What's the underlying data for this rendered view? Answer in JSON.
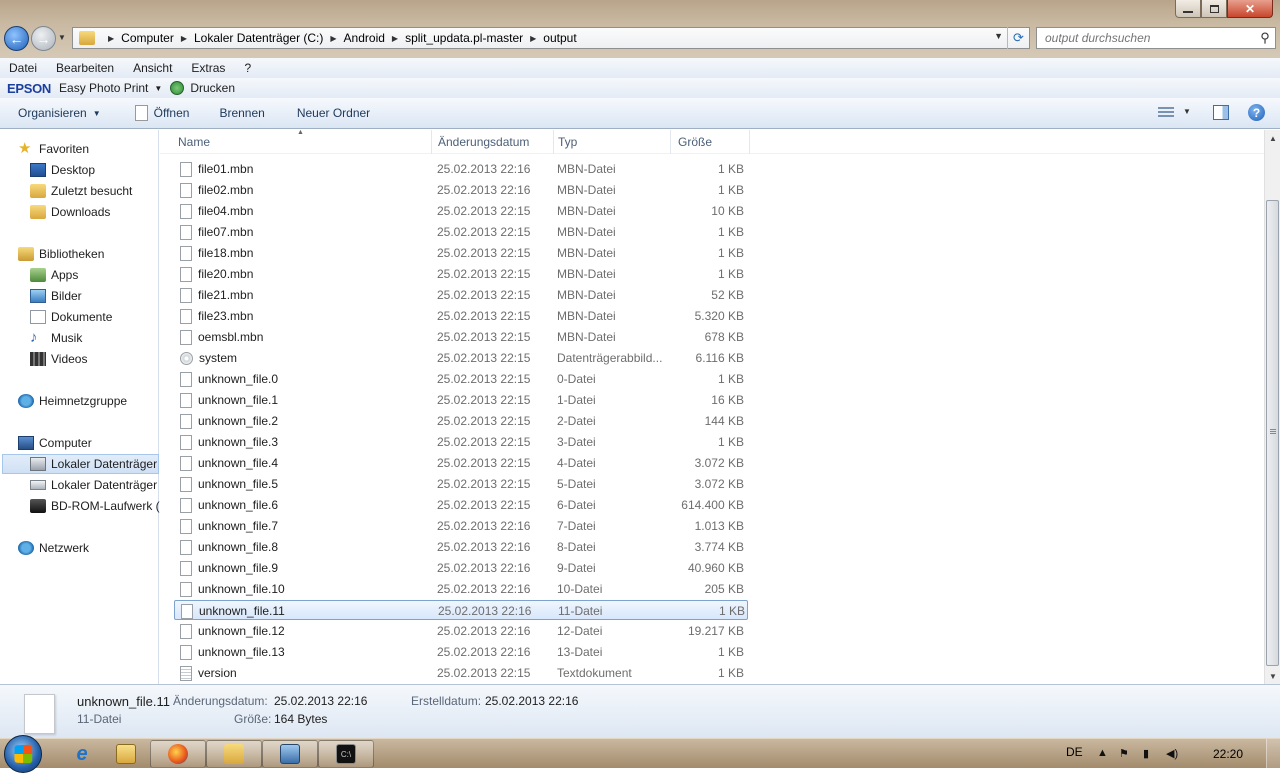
{
  "address": {
    "crumbs": [
      "Computer",
      "Lokaler Datenträger (C:)",
      "Android",
      "split_updata.pl-master",
      "output"
    ]
  },
  "search": {
    "placeholder": "output durchsuchen"
  },
  "menu": [
    "Datei",
    "Bearbeiten",
    "Ansicht",
    "Extras",
    "?"
  ],
  "epson": {
    "logo": "EPSON",
    "app": "Easy Photo Print",
    "print": "Drucken"
  },
  "toolbar": {
    "organize": "Organisieren",
    "open": "Öffnen",
    "burn": "Brennen",
    "new_folder": "Neuer Ordner"
  },
  "nav": {
    "favorites": "Favoriten",
    "desktop": "Desktop",
    "recent": "Zuletzt besucht",
    "downloads": "Downloads",
    "libraries": "Bibliotheken",
    "apps": "Apps",
    "pictures": "Bilder",
    "documents": "Dokumente",
    "music": "Musik",
    "videos": "Videos",
    "homegroup": "Heimnetzgruppe",
    "computer": "Computer",
    "drive1": "Lokaler Datenträger",
    "drive2": "Lokaler Datenträger",
    "bdrom": "BD-ROM-Laufwerk (",
    "network": "Netzwerk"
  },
  "columns": {
    "name": "Name",
    "date": "Änderungsdatum",
    "type": "Typ",
    "size": "Größe"
  },
  "files": [
    {
      "name": "file01.mbn",
      "date": "25.02.2013 22:16",
      "type": "MBN-Datei",
      "size": "1 KB",
      "icon": "file"
    },
    {
      "name": "file02.mbn",
      "date": "25.02.2013 22:16",
      "type": "MBN-Datei",
      "size": "1 KB",
      "icon": "file"
    },
    {
      "name": "file04.mbn",
      "date": "25.02.2013 22:15",
      "type": "MBN-Datei",
      "size": "10 KB",
      "icon": "file"
    },
    {
      "name": "file07.mbn",
      "date": "25.02.2013 22:15",
      "type": "MBN-Datei",
      "size": "1 KB",
      "icon": "file"
    },
    {
      "name": "file18.mbn",
      "date": "25.02.2013 22:15",
      "type": "MBN-Datei",
      "size": "1 KB",
      "icon": "file"
    },
    {
      "name": "file20.mbn",
      "date": "25.02.2013 22:15",
      "type": "MBN-Datei",
      "size": "1 KB",
      "icon": "file"
    },
    {
      "name": "file21.mbn",
      "date": "25.02.2013 22:15",
      "type": "MBN-Datei",
      "size": "52 KB",
      "icon": "file"
    },
    {
      "name": "file23.mbn",
      "date": "25.02.2013 22:15",
      "type": "MBN-Datei",
      "size": "5.320 KB",
      "icon": "file"
    },
    {
      "name": "oemsbl.mbn",
      "date": "25.02.2013 22:15",
      "type": "MBN-Datei",
      "size": "678 KB",
      "icon": "file"
    },
    {
      "name": "system",
      "date": "25.02.2013 22:15",
      "type": "Datenträgerabbild...",
      "size": "6.116 KB",
      "icon": "disc"
    },
    {
      "name": "unknown_file.0",
      "date": "25.02.2013 22:15",
      "type": "0-Datei",
      "size": "1 KB",
      "icon": "file"
    },
    {
      "name": "unknown_file.1",
      "date": "25.02.2013 22:15",
      "type": "1-Datei",
      "size": "16 KB",
      "icon": "file"
    },
    {
      "name": "unknown_file.2",
      "date": "25.02.2013 22:15",
      "type": "2-Datei",
      "size": "144 KB",
      "icon": "file"
    },
    {
      "name": "unknown_file.3",
      "date": "25.02.2013 22:15",
      "type": "3-Datei",
      "size": "1 KB",
      "icon": "file"
    },
    {
      "name": "unknown_file.4",
      "date": "25.02.2013 22:15",
      "type": "4-Datei",
      "size": "3.072 KB",
      "icon": "file"
    },
    {
      "name": "unknown_file.5",
      "date": "25.02.2013 22:15",
      "type": "5-Datei",
      "size": "3.072 KB",
      "icon": "file"
    },
    {
      "name": "unknown_file.6",
      "date": "25.02.2013 22:15",
      "type": "6-Datei",
      "size": "614.400 KB",
      "icon": "file"
    },
    {
      "name": "unknown_file.7",
      "date": "25.02.2013 22:16",
      "type": "7-Datei",
      "size": "1.013 KB",
      "icon": "file"
    },
    {
      "name": "unknown_file.8",
      "date": "25.02.2013 22:16",
      "type": "8-Datei",
      "size": "3.774 KB",
      "icon": "file"
    },
    {
      "name": "unknown_file.9",
      "date": "25.02.2013 22:16",
      "type": "9-Datei",
      "size": "40.960 KB",
      "icon": "file"
    },
    {
      "name": "unknown_file.10",
      "date": "25.02.2013 22:16",
      "type": "10-Datei",
      "size": "205 KB",
      "icon": "file"
    },
    {
      "name": "unknown_file.11",
      "date": "25.02.2013 22:16",
      "type": "11-Datei",
      "size": "1 KB",
      "icon": "file",
      "selected": true
    },
    {
      "name": "unknown_file.12",
      "date": "25.02.2013 22:16",
      "type": "12-Datei",
      "size": "19.217 KB",
      "icon": "file"
    },
    {
      "name": "unknown_file.13",
      "date": "25.02.2013 22:16",
      "type": "13-Datei",
      "size": "1 KB",
      "icon": "file"
    },
    {
      "name": "version",
      "date": "25.02.2013 22:15",
      "type": "Textdokument",
      "size": "1 KB",
      "icon": "text"
    }
  ],
  "details": {
    "name": "unknown_file.11",
    "type": "11-Datei",
    "modified_label": "Änderungsdatum:",
    "modified_value": "25.02.2013 22:16",
    "created_label": "Erstelldatum:",
    "created_value": "25.02.2013 22:16",
    "size_label": "Größe:",
    "size_value": "164 Bytes"
  },
  "taskbar": {
    "lang": "DE",
    "clock": "22:20"
  },
  "colors": {
    "accent": "#1e395b",
    "selection": "#d7e7fb",
    "brand_epson": "#1b3f9e"
  }
}
